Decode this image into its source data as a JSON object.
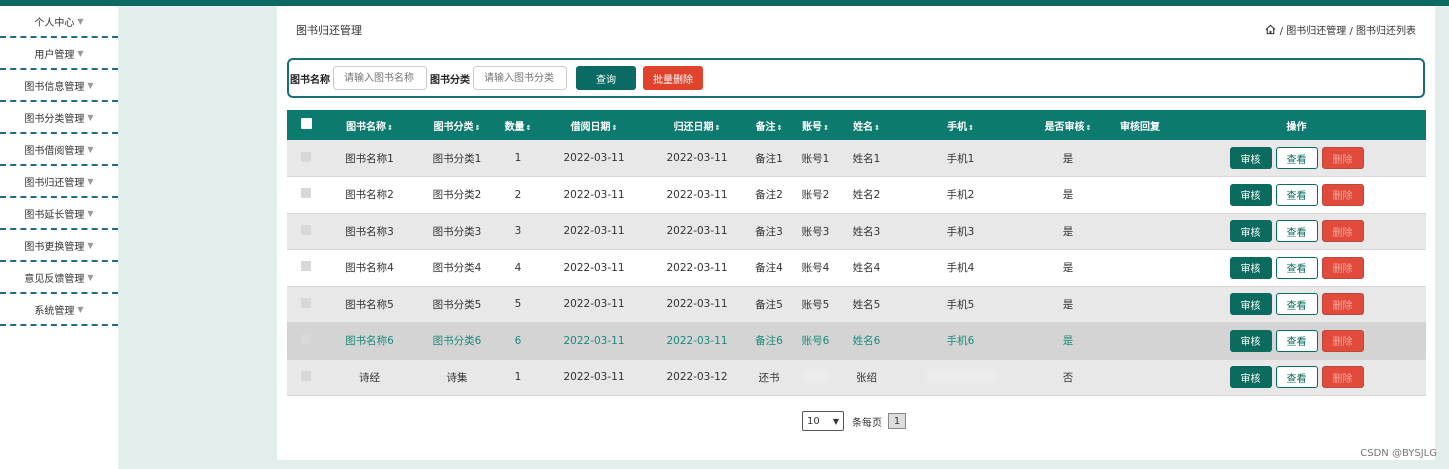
{
  "sidebar": {
    "items": [
      {
        "label": "个人中心"
      },
      {
        "label": "用户管理"
      },
      {
        "label": "图书信息管理"
      },
      {
        "label": "图书分类管理"
      },
      {
        "label": "图书借阅管理"
      },
      {
        "label": "图书归还管理"
      },
      {
        "label": "图书延长管理"
      },
      {
        "label": "图书更换管理"
      },
      {
        "label": "意见反馈管理"
      },
      {
        "label": "系统管理"
      }
    ]
  },
  "header": {
    "title": "图书归还管理",
    "breadcrumb": "/ 图书归还管理 / 图书归还列表"
  },
  "search": {
    "name_label": "图书名称",
    "name_placeholder": "请输入图书名称",
    "category_label": "图书分类",
    "category_placeholder": "请输入图书分类",
    "query_button": "查询",
    "batch_delete_button": "批量删除"
  },
  "table": {
    "headers": [
      "图书名称",
      "图书分类",
      "数量",
      "借阅日期",
      "归还日期",
      "备注",
      "账号",
      "姓名",
      "手机",
      "是否审核",
      "审核回复",
      "操作"
    ],
    "rows": [
      {
        "name": "图书名称1",
        "category": "图书分类1",
        "qty": "1",
        "borrow": "2022-03-11",
        "return": "2022-03-11",
        "note": "备注1",
        "account": "账号1",
        "person": "姓名1",
        "phone": "手机1",
        "audited": "是",
        "reply": ""
      },
      {
        "name": "图书名称2",
        "category": "图书分类2",
        "qty": "2",
        "borrow": "2022-03-11",
        "return": "2022-03-11",
        "note": "备注2",
        "account": "账号2",
        "person": "姓名2",
        "phone": "手机2",
        "audited": "是",
        "reply": ""
      },
      {
        "name": "图书名称3",
        "category": "图书分类3",
        "qty": "3",
        "borrow": "2022-03-11",
        "return": "2022-03-11",
        "note": "备注3",
        "account": "账号3",
        "person": "姓名3",
        "phone": "手机3",
        "audited": "是",
        "reply": ""
      },
      {
        "name": "图书名称4",
        "category": "图书分类4",
        "qty": "4",
        "borrow": "2022-03-11",
        "return": "2022-03-11",
        "note": "备注4",
        "account": "账号4",
        "person": "姓名4",
        "phone": "手机4",
        "audited": "是",
        "reply": ""
      },
      {
        "name": "图书名称5",
        "category": "图书分类5",
        "qty": "5",
        "borrow": "2022-03-11",
        "return": "2022-03-11",
        "note": "备注5",
        "account": "账号5",
        "person": "姓名5",
        "phone": "手机5",
        "audited": "是",
        "reply": ""
      },
      {
        "name": "图书名称6",
        "category": "图书分类6",
        "qty": "6",
        "borrow": "2022-03-11",
        "return": "2022-03-11",
        "note": "备注6",
        "account": "账号6",
        "person": "姓名6",
        "phone": "手机6",
        "audited": "是",
        "reply": ""
      },
      {
        "name": "诗经",
        "category": "诗集",
        "qty": "1",
        "borrow": "2022-03-11",
        "return": "2022-03-12",
        "note": "还书",
        "account": "",
        "person": "张绍",
        "phone": "",
        "audited": "否",
        "reply": ""
      }
    ],
    "actions": {
      "audit": "审核",
      "view": "查看",
      "delete": "删除"
    }
  },
  "pagination": {
    "page_size": "10",
    "per_page_label": "条每页",
    "current_page": "1"
  },
  "watermark": "CSDN @BYSJLG",
  "colors": {
    "primary": "#0c7a6e",
    "danger": "#e0432c",
    "sidebar_divider": "#1f6f7c"
  }
}
